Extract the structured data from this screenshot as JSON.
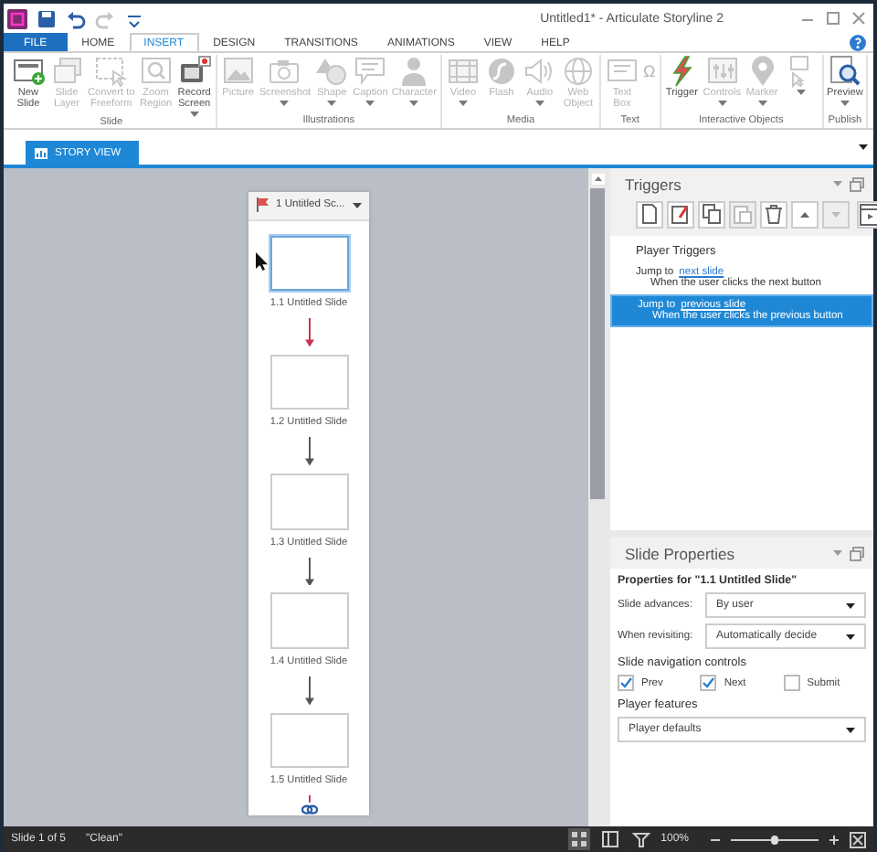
{
  "window": {
    "title": "Untitled1* - Articulate Storyline 2",
    "quick_access": [
      {
        "kind": "save",
        "disabled": false
      },
      {
        "kind": "undo",
        "disabled": false
      },
      {
        "kind": "redo",
        "disabled": true
      },
      {
        "kind": "customize",
        "disabled": false
      }
    ]
  },
  "menu_tabs": [
    {
      "label": "FILE",
      "kind": "file",
      "selected": false
    },
    {
      "label": "HOME",
      "kind": "tab",
      "selected": false
    },
    {
      "label": "INSERT",
      "kind": "tab",
      "selected": true
    },
    {
      "label": "DESIGN",
      "kind": "tab",
      "selected": false
    },
    {
      "label": "TRANSITIONS",
      "kind": "tab",
      "selected": false
    },
    {
      "label": "ANIMATIONS",
      "kind": "tab",
      "selected": false
    },
    {
      "label": "VIEW",
      "kind": "tab",
      "selected": false
    },
    {
      "label": "HELP",
      "kind": "tab",
      "selected": false
    }
  ],
  "ribbon": [
    {
      "label": "Slide",
      "buttons": [
        {
          "kind": "button",
          "label": "New\nSlide",
          "disabled": false,
          "has_menu": false
        },
        {
          "kind": "button",
          "label": "Slide\nLayer",
          "disabled": true,
          "has_menu": false
        },
        {
          "kind": "button",
          "label": "Convert to\nFreeform",
          "disabled": true,
          "has_menu": false
        },
        {
          "kind": "button",
          "label": "Zoom\nRegion",
          "disabled": true,
          "has_menu": false
        },
        {
          "kind": "button",
          "label": "Record\nScreen",
          "disabled": false,
          "has_menu": true
        }
      ]
    },
    {
      "label": "Illustrations",
      "buttons": [
        {
          "kind": "button",
          "label": "Picture",
          "disabled": true,
          "has_menu": false
        },
        {
          "kind": "button",
          "label": "Screenshot",
          "disabled": true,
          "has_menu": true
        },
        {
          "kind": "button",
          "label": "Shape",
          "disabled": true,
          "has_menu": true
        },
        {
          "kind": "button",
          "label": "Caption",
          "disabled": true,
          "has_menu": true
        },
        {
          "kind": "button",
          "label": "Character",
          "disabled": true,
          "has_menu": true
        }
      ]
    },
    {
      "label": "Media",
      "buttons": [
        {
          "kind": "button",
          "label": "Video",
          "disabled": true,
          "has_menu": true
        },
        {
          "kind": "button",
          "label": "Flash",
          "disabled": true,
          "has_menu": false
        },
        {
          "kind": "button",
          "label": "Audio",
          "disabled": true,
          "has_menu": true
        },
        {
          "kind": "button",
          "label": "Web\nObject",
          "disabled": true,
          "has_menu": false
        }
      ]
    },
    {
      "label": "Text",
      "buttons": [
        {
          "kind": "button",
          "label": "Text\nBox",
          "disabled": true,
          "has_menu": false
        },
        {
          "kind": "glyph",
          "label": "Ω",
          "disabled": true,
          "has_menu": false
        }
      ]
    },
    {
      "label": "Interactive Objects",
      "buttons": [
        {
          "kind": "button",
          "label": "Trigger",
          "disabled": false,
          "has_menu": false
        },
        {
          "kind": "button",
          "label": "Controls",
          "disabled": true,
          "has_menu": true
        },
        {
          "kind": "button",
          "label": "Marker",
          "disabled": true,
          "has_menu": true
        },
        {
          "kind": "icon",
          "disabled": true,
          "has_menu": true
        }
      ]
    },
    {
      "label": "Publish",
      "buttons": [
        {
          "kind": "button",
          "label": "Preview",
          "disabled": false,
          "has_menu": true
        }
      ]
    }
  ],
  "view_tabs": [
    {
      "label": "STORY VIEW",
      "selected": true
    }
  ],
  "story": {
    "scene": {
      "title": "1 Untitled Sc..."
    },
    "slides": [
      {
        "label": "1.1 Untitled Slide",
        "selected": true
      },
      {
        "label": "1.2 Untitled Slide",
        "selected": false
      },
      {
        "label": "1.3 Untitled Slide",
        "selected": false
      },
      {
        "label": "1.4 Untitled Slide",
        "selected": false
      },
      {
        "label": "1.5 Untitled Slide",
        "selected": false
      }
    ],
    "links": [
      {
        "color": "#c2334d"
      },
      {
        "color": "#555555"
      },
      {
        "color": "#555555"
      },
      {
        "color": "#555555"
      }
    ]
  },
  "triggers_panel": {
    "title": "Triggers",
    "toolbar": [
      {
        "disabled": false
      },
      {
        "disabled": false
      },
      {
        "disabled": false
      },
      {
        "disabled": true
      },
      {
        "disabled": false
      },
      {
        "disabled": false
      },
      {
        "disabled": true
      },
      {
        "disabled": false
      }
    ],
    "group": "Player Triggers",
    "items": [
      {
        "action": "Jump to",
        "target": "next slide",
        "condition": "When the user clicks the next button",
        "selected": false
      },
      {
        "action": "Jump to",
        "target": "previous slide",
        "condition": "When the user clicks the previous button",
        "selected": true
      }
    ]
  },
  "slide_properties": {
    "title": "Slide Properties",
    "heading": "Properties for \"1.1 Untitled Slide\"",
    "fields": [
      {
        "label": "Slide advances:",
        "value": "By user"
      },
      {
        "label": "When revisiting:",
        "value": "Automatically decide"
      }
    ],
    "nav_heading": "Slide navigation controls",
    "nav_controls": [
      {
        "label": "Prev",
        "checked": true
      },
      {
        "label": "Next",
        "checked": true
      },
      {
        "label": "Submit",
        "checked": false
      }
    ],
    "player_heading": "Player features",
    "player_value": "Player defaults"
  },
  "status_bar": {
    "slide": "Slide 1 of 5",
    "theme": "\"Clean\"",
    "views": [
      {
        "selected": true
      },
      {
        "selected": false
      },
      {
        "selected": false
      }
    ],
    "zoom": "100%",
    "zoom_slider": {
      "level": 0.5
    }
  }
}
